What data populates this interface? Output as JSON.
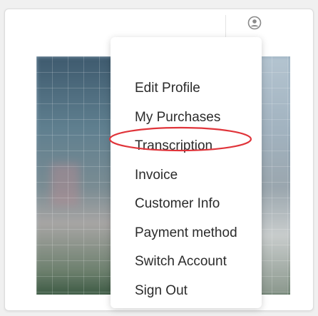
{
  "header": {
    "avatar_icon": "user-circle-icon"
  },
  "menu": {
    "items": [
      {
        "label": "Edit Profile"
      },
      {
        "label": "My Purchases"
      },
      {
        "label": "Transcription"
      },
      {
        "label": "Invoice"
      },
      {
        "label": "Customer Info"
      },
      {
        "label": "Payment method"
      },
      {
        "label": "Switch Account"
      },
      {
        "label": "Sign Out"
      }
    ]
  },
  "annotation": {
    "target": "Transcription",
    "shape": "ellipse",
    "color": "#e0343a"
  },
  "colors": {
    "menu_text": "#2b2b2b",
    "annotation": "#e0343a"
  }
}
